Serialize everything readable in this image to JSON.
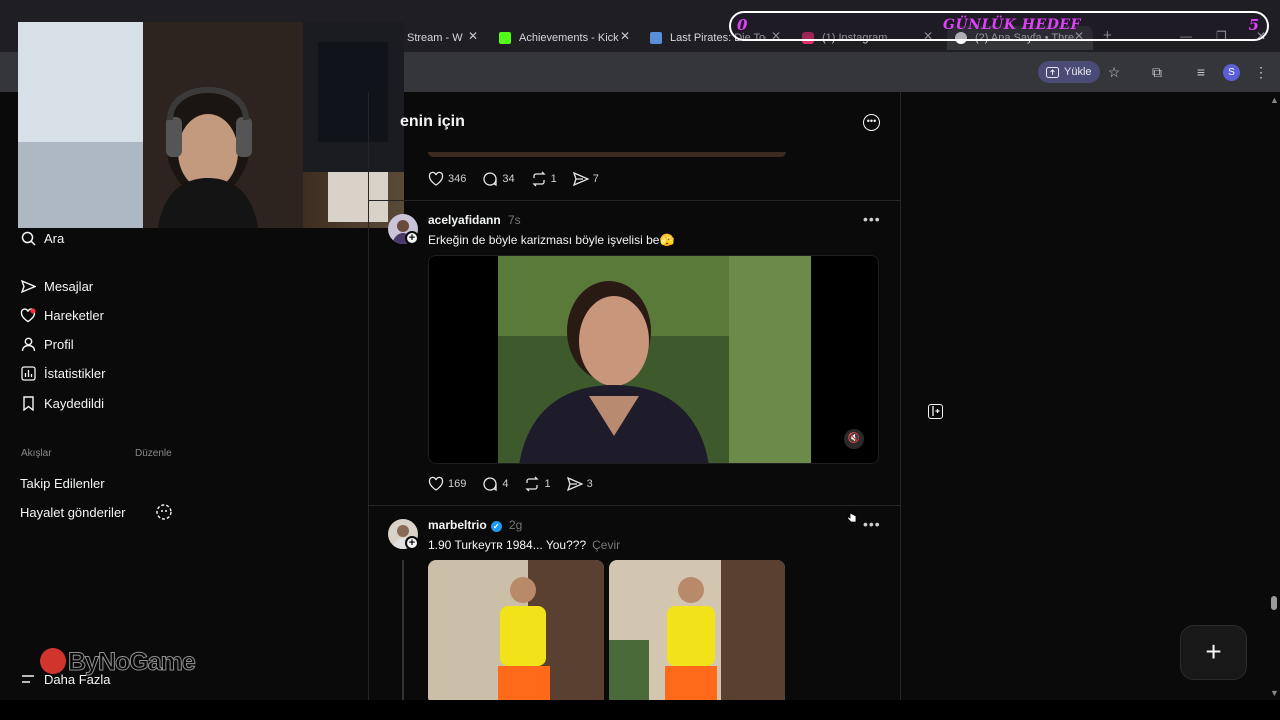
{
  "browser": {
    "tabs": [
      {
        "label": "Stream - W",
        "favicon_color": "#9b6bf2"
      },
      {
        "label": "Achievements - Kick",
        "favicon_color": "#53fc18"
      },
      {
        "label": "Last Pirates: Die Toge",
        "favicon_color": "#5a8fd8"
      },
      {
        "label": "(1) Instagram",
        "favicon_color": "#e1306c"
      },
      {
        "label": "(2) Ana Sayfa • Threa",
        "favicon_color": "#ffffff"
      }
    ],
    "upload_label": "Yükle",
    "profile_initial": "S",
    "overlay": {
      "left": "0",
      "title": "GÜNLÜK HEDEF",
      "right": "5"
    }
  },
  "sidebar": {
    "search": "Ara",
    "items": [
      {
        "label": "Mesajlar",
        "icon": "send-icon"
      },
      {
        "label": "Hareketler",
        "icon": "heart-icon"
      },
      {
        "label": "Profil",
        "icon": "user-icon"
      },
      {
        "label": "İstatistikler",
        "icon": "stats-icon"
      },
      {
        "label": "Kaydedildi",
        "icon": "bookmark-icon"
      }
    ],
    "feeds_label": "Akışlar",
    "feeds_edit": "Düzenle",
    "feeds": [
      "Takip Edilenler",
      "Hayalet gönderiler"
    ],
    "more": "Daha Fazla",
    "watermark": "ByNoGame"
  },
  "feed": {
    "title": "enin için",
    "prev_post_actions": {
      "likes": "346",
      "replies": "34",
      "reposts": "1",
      "shares": "7"
    },
    "posts": [
      {
        "username": "acelyafidann",
        "time": "7s",
        "text": "Erkeğin de böyle karizması böyle işvelisi be🫣",
        "actions": {
          "likes": "169",
          "replies": "4",
          "reposts": "1",
          "shares": "3"
        }
      },
      {
        "username": "marbeltrio",
        "time": "2g",
        "text": "1.90 Turkeyᴛʀ 1984... You???",
        "translate": "Çevir"
      }
    ]
  },
  "colors": {
    "accent": "#e040fb",
    "bg": "#0a0a0a",
    "border": "#262626"
  }
}
